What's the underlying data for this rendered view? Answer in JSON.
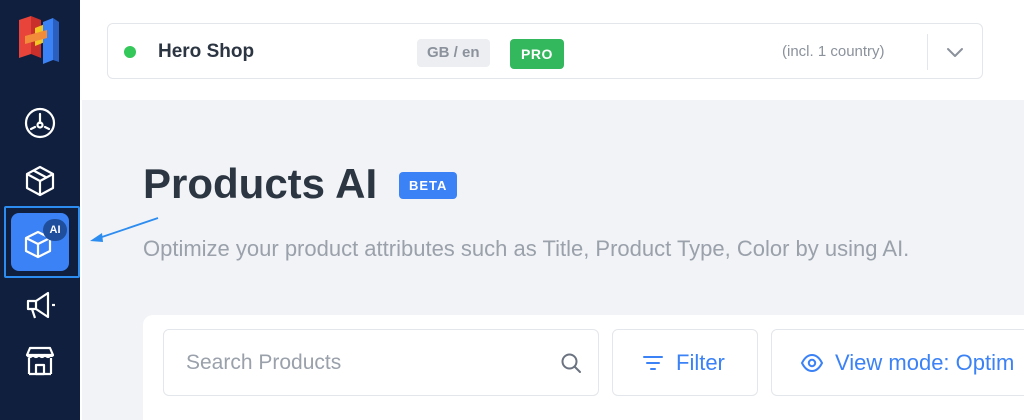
{
  "topbar": {
    "shop_name": "Hero Shop",
    "locale": "GB / en",
    "plan": "PRO",
    "country_note": "(incl. 1 country)",
    "status_color": "#34c759"
  },
  "page": {
    "title": "Products AI",
    "badge": "BETA",
    "subtitle": "Optimize your product attributes such as Title, Product Type, Color by using AI."
  },
  "sidebar": {
    "items": [
      {
        "name": "dashboard",
        "icon": "gauge-icon"
      },
      {
        "name": "products",
        "icon": "cube-icon"
      },
      {
        "name": "products-ai",
        "icon": "cube-ai-icon",
        "badge": "AI",
        "active": true
      },
      {
        "name": "marketing",
        "icon": "megaphone-icon"
      },
      {
        "name": "store",
        "icon": "storefront-icon"
      }
    ],
    "accent": "#3b82f6",
    "background": "#0f1f3d"
  },
  "toolbar": {
    "search_placeholder": "Search Products",
    "filter_label": "Filter",
    "view_mode_label": "View mode: Optim"
  }
}
